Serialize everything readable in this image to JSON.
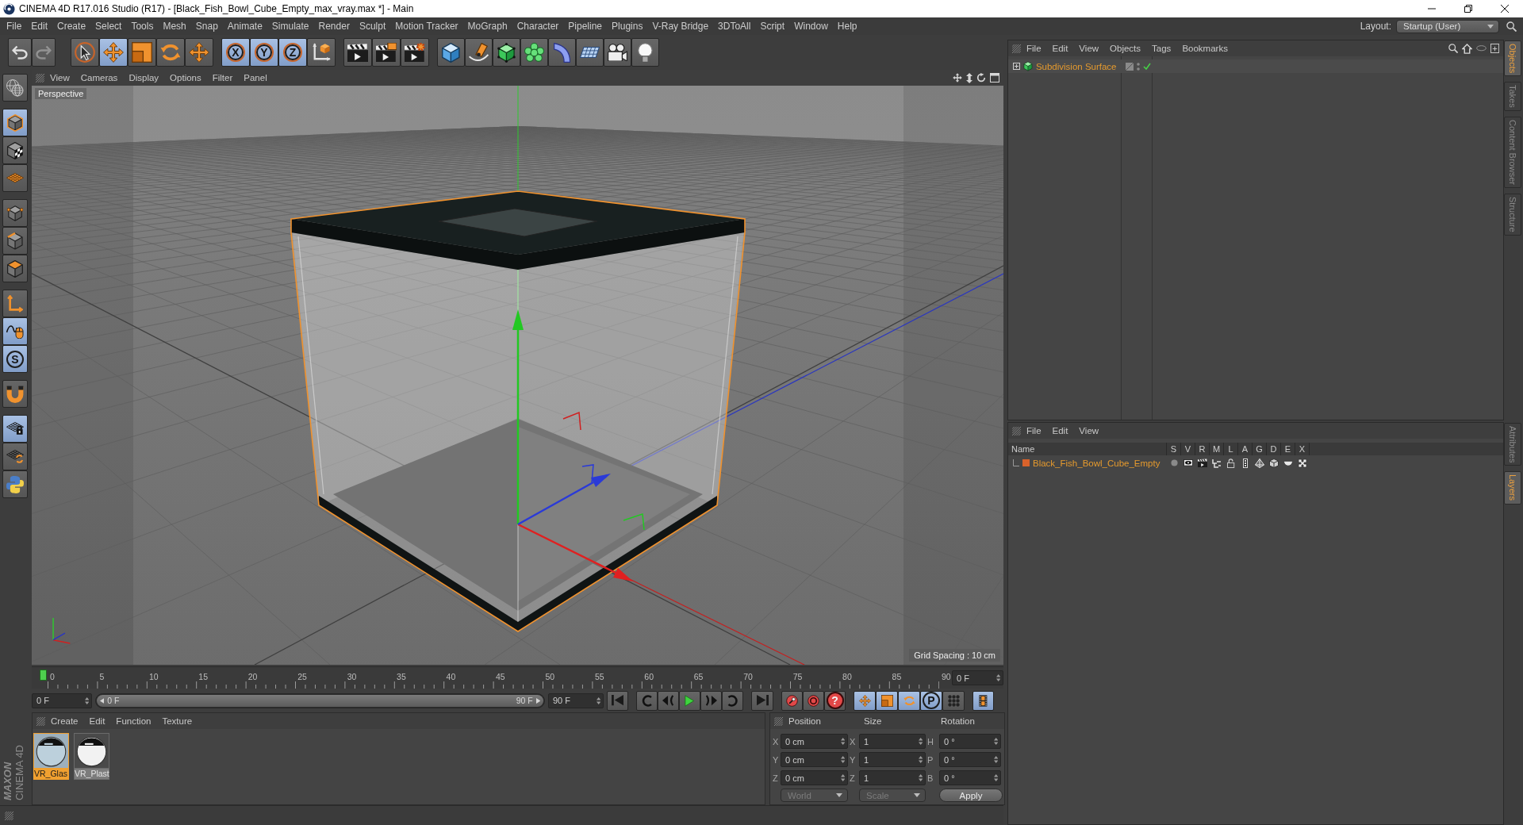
{
  "window": {
    "title": "CINEMA 4D R17.016 Studio (R17) - [Black_Fish_Bowl_Cube_Empty_max_vray.max *] - Main"
  },
  "menu_bar": {
    "items": [
      "File",
      "Edit",
      "Create",
      "Select",
      "Tools",
      "Mesh",
      "Snap",
      "Animate",
      "Simulate",
      "Render",
      "Sculpt",
      "Motion Tracker",
      "MoGraph",
      "Character",
      "Pipeline",
      "Plugins",
      "V-Ray Bridge",
      "3DToAll",
      "Script",
      "Window",
      "Help"
    ],
    "layout_label": "Layout:",
    "layout_value": "Startup (User)"
  },
  "toolbar": {
    "groups": [
      {
        "buttons": [
          {
            "kind": "undo",
            "selected": false,
            "disabled": false
          },
          {
            "kind": "redo",
            "selected": false,
            "disabled": true
          }
        ]
      },
      {
        "buttons": [
          {
            "kind": "live-select",
            "selected": false,
            "disabled": false
          },
          {
            "kind": "move",
            "selected": true,
            "disabled": false
          },
          {
            "kind": "scale",
            "selected": false,
            "disabled": false
          },
          {
            "kind": "rotate",
            "selected": false,
            "disabled": false
          },
          {
            "kind": "recent-tool",
            "selected": false,
            "disabled": false
          }
        ]
      },
      {
        "buttons": [
          {
            "kind": "axis-lock",
            "label": "X",
            "selected": true,
            "disabled": false
          },
          {
            "kind": "axis-lock",
            "label": "Y",
            "selected": true,
            "disabled": false
          },
          {
            "kind": "axis-lock",
            "label": "Z",
            "selected": true,
            "disabled": false
          },
          {
            "kind": "coordinate-system",
            "selected": false,
            "disabled": false
          }
        ]
      },
      {
        "buttons": [
          {
            "kind": "render-view",
            "selected": false,
            "disabled": false
          },
          {
            "kind": "render-picture",
            "selected": false,
            "disabled": false
          },
          {
            "kind": "render-settings",
            "selected": false,
            "disabled": false
          }
        ]
      },
      {
        "buttons": [
          {
            "kind": "cube",
            "selected": false,
            "disabled": false
          },
          {
            "kind": "pen",
            "selected": false,
            "disabled": false
          },
          {
            "kind": "subdivision",
            "selected": false,
            "disabled": false
          },
          {
            "kind": "cloner",
            "selected": false,
            "disabled": false
          },
          {
            "kind": "deformer",
            "selected": false,
            "disabled": false
          },
          {
            "kind": "floor",
            "selected": false,
            "disabled": false
          },
          {
            "kind": "camera",
            "selected": false,
            "disabled": false
          },
          {
            "kind": "light",
            "selected": false,
            "disabled": false
          }
        ]
      }
    ]
  },
  "left_toolbar": {
    "groups": [
      {
        "buttons": [
          {
            "kind": "make-editable",
            "selected": false
          }
        ]
      },
      {
        "buttons": [
          {
            "kind": "model-mode",
            "selected": true
          },
          {
            "kind": "texture-mode",
            "selected": false
          },
          {
            "kind": "workplane-mode",
            "selected": false
          }
        ]
      },
      {
        "buttons": [
          {
            "kind": "points-mode",
            "selected": false
          },
          {
            "kind": "edges-mode",
            "selected": false
          },
          {
            "kind": "polygons-mode",
            "selected": false
          }
        ]
      },
      {
        "buttons": [
          {
            "kind": "axis-mode",
            "selected": false
          },
          {
            "kind": "tweak-mode",
            "selected": true
          },
          {
            "kind": "solo",
            "label": "S",
            "selected": true
          }
        ]
      },
      {
        "buttons": [
          {
            "kind": "snap",
            "selected": false
          }
        ]
      },
      {
        "buttons": [
          {
            "kind": "lock-workplane",
            "selected": true
          },
          {
            "kind": "workplane-align",
            "selected": false
          },
          {
            "kind": "python",
            "selected": false
          }
        ]
      }
    ]
  },
  "viewport": {
    "menu": [
      "View",
      "Cameras",
      "Display",
      "Options",
      "Filter",
      "Panel"
    ],
    "camera": "Perspective",
    "grid_spacing": "Grid Spacing : 10 cm"
  },
  "timeline": {
    "labels": [
      "0",
      "5",
      "10",
      "15",
      "20",
      "25",
      "30",
      "35",
      "40",
      "45",
      "50",
      "55",
      "60",
      "65",
      "70",
      "75",
      "80",
      "85",
      "90"
    ],
    "level": 0,
    "frame": "0 F"
  },
  "transport": {
    "start_frame": "0 F",
    "range": {
      "start": "0 F",
      "end": "90 F",
      "level": 1
    },
    "end_frame": "90 F",
    "groups": [
      {
        "buttons": [
          {
            "kind": "go-start",
            "selected": false
          }
        ]
      },
      {
        "buttons": [
          {
            "kind": "prev-key",
            "selected": false
          },
          {
            "kind": "step-back",
            "selected": false
          },
          {
            "kind": "play",
            "selected": false
          },
          {
            "kind": "step-forward",
            "selected": false
          },
          {
            "kind": "next-key",
            "selected": false
          }
        ]
      },
      {
        "buttons": [
          {
            "kind": "go-end",
            "selected": false
          }
        ]
      },
      {
        "buttons": [
          {
            "kind": "record",
            "selected": false
          },
          {
            "kind": "autokey",
            "selected": false
          },
          {
            "kind": "key-query",
            "label": "?",
            "selected": false
          }
        ]
      },
      {
        "buttons": [
          {
            "kind": "move-key",
            "selected": true
          },
          {
            "kind": "scale-key",
            "selected": true
          },
          {
            "kind": "rotate-key",
            "selected": true
          },
          {
            "kind": "param-key",
            "label": "P",
            "selected": true
          },
          {
            "kind": "pla-key",
            "selected": false
          }
        ]
      },
      {
        "buttons": [
          {
            "kind": "timeline",
            "selected": true
          }
        ]
      }
    ]
  },
  "materials": {
    "menu": [
      "Create",
      "Edit",
      "Function",
      "Texture"
    ],
    "items": [
      {
        "name": "VR_Glas",
        "kind": "glass",
        "selected": true
      },
      {
        "name": "VR_Plast",
        "kind": "plastic",
        "selected": false
      }
    ]
  },
  "coordinates": {
    "headers": [
      "Position",
      "Size",
      "Rotation"
    ],
    "rows": [
      {
        "labels": [
          "X",
          "X",
          "H"
        ],
        "values": [
          "0 cm",
          "1",
          "0 °"
        ]
      },
      {
        "labels": [
          "Y",
          "Y",
          "P"
        ],
        "values": [
          "0 cm",
          "1",
          "0 °"
        ]
      },
      {
        "labels": [
          "Z",
          "Z",
          "B"
        ],
        "values": [
          "0 cm",
          "1",
          "0 °"
        ]
      }
    ],
    "dropdowns": [
      {
        "value": "World",
        "disabled": true
      },
      {
        "value": "Scale",
        "disabled": true
      }
    ],
    "apply": "Apply"
  },
  "object_manager": {
    "menu": [
      "File",
      "Edit",
      "View",
      "Objects",
      "Tags",
      "Bookmarks"
    ],
    "objects": [
      {
        "name": "Subdivision Surface",
        "selected": true,
        "expanded": false,
        "enabled": true
      }
    ]
  },
  "layer_manager": {
    "menu": [
      "File",
      "Edit",
      "View"
    ],
    "columns": [
      "Name",
      "S",
      "V",
      "R",
      "M",
      "L",
      "A",
      "G",
      "D",
      "E",
      "X"
    ],
    "layers": [
      {
        "name": "Black_Fish_Bowl_Cube_Empty",
        "color": "#d9622b",
        "selected": true,
        "solo": false,
        "locked": false
      }
    ]
  },
  "side_tabs": {
    "top": [
      {
        "label": "Objects",
        "selected": true
      },
      {
        "label": "Takes",
        "selected": false
      },
      {
        "label": "Content Browser",
        "selected": false
      },
      {
        "label": "Structure",
        "selected": false
      }
    ],
    "bottom": [
      {
        "label": "Attributes",
        "selected": false
      },
      {
        "label": "Layers",
        "selected": true
      }
    ]
  },
  "brand": {
    "company": "MAXON",
    "product": "CINEMA 4D"
  }
}
